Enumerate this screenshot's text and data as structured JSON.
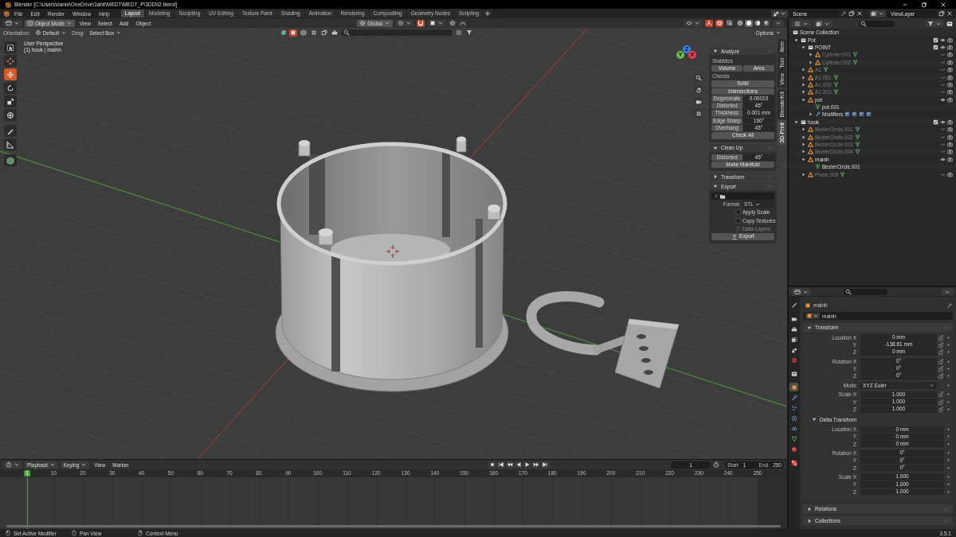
{
  "window": {
    "title": "Blender [C:\\Users\\danie\\OneDrive\\3ahit\\MEDT\\MEDT_P\\3DD\\t2.blend]"
  },
  "menu": [
    "File",
    "Edit",
    "Render",
    "Window",
    "Help"
  ],
  "workspaces": [
    {
      "label": "Layout",
      "selected": true
    },
    {
      "label": "Modeling",
      "selected": false
    },
    {
      "label": "Sculpting",
      "selected": false
    },
    {
      "label": "UV Editing",
      "selected": false
    },
    {
      "label": "Texture Paint",
      "selected": false
    },
    {
      "label": "Shading",
      "selected": false
    },
    {
      "label": "Animation",
      "selected": false
    },
    {
      "label": "Rendering",
      "selected": false
    },
    {
      "label": "Compositing",
      "selected": false
    },
    {
      "label": "Geometry Nodes",
      "selected": false
    },
    {
      "label": "Scripting",
      "selected": false
    }
  ],
  "scene": "Scene",
  "view_layer": "ViewLayer",
  "viewport": {
    "mode": "Object Mode",
    "menus": [
      "View",
      "Select",
      "Add",
      "Object"
    ],
    "transform_orientation": "Global",
    "options": "Options",
    "orientation_label": "Orientation:",
    "orientation": "Default",
    "drag_label": "Drag:",
    "drag": "Select Box",
    "info": [
      "User Perspective",
      "(1) hook | mainh"
    ],
    "shading": [
      {
        "kind": "wireframe",
        "selected": false
      },
      {
        "kind": "solid",
        "selected": true
      },
      {
        "kind": "material",
        "selected": false
      },
      {
        "kind": "rendered",
        "selected": false
      }
    ],
    "tools": [
      {
        "kind": "select",
        "selected": false
      },
      {
        "kind": "cursor",
        "selected": false
      },
      {
        "kind": "move",
        "selected": true
      },
      {
        "kind": "rotate",
        "selected": false
      },
      {
        "kind": "scale",
        "selected": false
      },
      {
        "kind": "transform",
        "selected": false
      },
      {
        "kind": "annotate",
        "selected": false
      },
      {
        "kind": "measure",
        "selected": false
      },
      {
        "kind": "add_cube",
        "selected": false
      }
    ],
    "gizmo": [
      {
        "label": "Z",
        "color": "#2f86f0"
      },
      {
        "label": "Y",
        "color": "#6bbd4d"
      },
      {
        "label": "X",
        "color": "#f0374f"
      }
    ],
    "sidebar": {
      "tabs": [
        {
          "label": "Item",
          "selected": false
        },
        {
          "label": "Tool",
          "selected": false
        },
        {
          "label": "View",
          "selected": false
        },
        {
          "label": "BlenderKit",
          "selected": false
        },
        {
          "label": "3D-Print",
          "selected": true
        }
      ],
      "panels": [
        {
          "title": "Analyze",
          "expanded": true,
          "rows": [
            {
              "kind": "label",
              "text": "Statistics"
            },
            {
              "kind": "buttons",
              "items": [
                "Volume",
                "Area"
              ]
            },
            {
              "kind": "label",
              "text": "Checks"
            },
            {
              "kind": "button",
              "text": "Solid"
            },
            {
              "kind": "button",
              "text": "Intersections"
            },
            {
              "kind": "prop",
              "label": "Degenerate",
              "value": "0.00010"
            },
            {
              "kind": "prop",
              "label": "Distorted",
              "value": "45°"
            },
            {
              "kind": "prop",
              "label": "Thickness",
              "value": "0.001 mm"
            },
            {
              "kind": "prop",
              "label": "Edge Sharp",
              "value": "160°"
            },
            {
              "kind": "prop",
              "label": "Overhang",
              "value": "45°"
            },
            {
              "kind": "button",
              "text": "Check All"
            }
          ]
        },
        {
          "title": "Clean Up",
          "expanded": true,
          "rows": [
            {
              "kind": "prop",
              "label": "Distorted",
              "value": "45°"
            },
            {
              "kind": "button",
              "text": "Make Manifold"
            }
          ]
        },
        {
          "title": "Transform",
          "expanded": false
        },
        {
          "title": "Export",
          "expanded": true,
          "rows": [
            {
              "kind": "path",
              "value": "//"
            },
            {
              "kind": "select",
              "label": "Format",
              "value": "STL"
            },
            {
              "kind": "checkbox",
              "label": "Apply Scale",
              "checked": false,
              "disabled": false
            },
            {
              "kind": "checkbox",
              "label": "Copy Textures",
              "checked": false,
              "disabled": false
            },
            {
              "kind": "checkbox",
              "label": "Data Layers",
              "checked": false,
              "disabled": true
            },
            {
              "kind": "icon_button",
              "text": "Export"
            }
          ]
        }
      ]
    }
  },
  "outliner": {
    "root": "Scene Collection",
    "items": [
      {
        "name": "Pot",
        "kind": "collection",
        "expanded": true,
        "checked": true,
        "hidden": false,
        "children": [
          {
            "name": "POINT",
            "kind": "collection",
            "expanded": true,
            "checked": true,
            "hidden": false,
            "children": [
              {
                "name": "Cylinder.001",
                "kind": "object",
                "expanded": false,
                "hidden": true
              },
              {
                "name": "Cylinder.002",
                "kind": "object",
                "expanded": false,
                "hidden": true
              }
            ]
          },
          {
            "name": "A1",
            "kind": "object",
            "expanded": false,
            "hidden": true
          },
          {
            "name": "A1.001",
            "kind": "object",
            "expanded": false,
            "hidden": true
          },
          {
            "name": "A1.002",
            "kind": "object",
            "expanded": false,
            "hidden": true
          },
          {
            "name": "A1.003",
            "kind": "object",
            "expanded": false,
            "hidden": true
          },
          {
            "name": "pot",
            "kind": "object",
            "expanded": true,
            "hidden": false,
            "children": [
              {
                "name": "pot.001",
                "kind": "mesh"
              },
              {
                "name": "Modifiers",
                "kind": "modifiers",
                "expanded": false
              }
            ]
          }
        ]
      },
      {
        "name": "hook",
        "kind": "collection",
        "expanded": true,
        "checked": true,
        "hidden": false,
        "children": [
          {
            "name": "BezierCircle.001",
            "kind": "object",
            "expanded": false,
            "hidden": true
          },
          {
            "name": "BezierCircle.002",
            "kind": "object",
            "expanded": false,
            "hidden": true
          },
          {
            "name": "BezierCircle.003",
            "kind": "object",
            "expanded": false,
            "hidden": true
          },
          {
            "name": "BezierCircle.004",
            "kind": "object",
            "expanded": false,
            "hidden": true
          },
          {
            "name": "mainh",
            "kind": "object",
            "expanded": true,
            "hidden": false,
            "children": [
              {
                "name": "BezierCircle.001",
                "kind": "mesh"
              }
            ]
          },
          {
            "name": "Plane.008",
            "kind": "object",
            "expanded": false,
            "hidden": true
          }
        ]
      }
    ]
  },
  "properties": {
    "tabs": [
      {
        "kind": "tool",
        "selected": false
      },
      {
        "kind": "render",
        "selected": false
      },
      {
        "kind": "output",
        "selected": false
      },
      {
        "kind": "view_layer",
        "selected": false
      },
      {
        "kind": "scene",
        "selected": false
      },
      {
        "kind": "world",
        "selected": false
      },
      {
        "kind": "collection",
        "selected": false
      },
      {
        "kind": "object",
        "selected": true
      },
      {
        "kind": "modifiers",
        "selected": false
      },
      {
        "kind": "particles",
        "selected": false
      },
      {
        "kind": "physics",
        "selected": false
      },
      {
        "kind": "constraints",
        "selected": false
      },
      {
        "kind": "data",
        "selected": false
      },
      {
        "kind": "material",
        "selected": false
      },
      {
        "kind": "texture",
        "selected": false
      }
    ],
    "object": "mainh",
    "datablock": "mainh",
    "panels": [
      {
        "title": "Transform",
        "expanded": true,
        "groups": [
          [
            {
              "kind": "number",
              "label": "Location X",
              "value": "0 mm",
              "locked": false
            },
            {
              "kind": "number",
              "label": "Y",
              "value": "-138.61 mm",
              "locked": false
            },
            {
              "kind": "number",
              "label": "Z",
              "value": "0 mm",
              "locked": false
            }
          ],
          [
            {
              "kind": "number",
              "label": "Rotation X",
              "value": "0°",
              "locked": false
            },
            {
              "kind": "number",
              "label": "Y",
              "value": "0°",
              "locked": false
            },
            {
              "kind": "number",
              "label": "Z",
              "value": "0°",
              "locked": false
            }
          ],
          [
            {
              "kind": "select",
              "label": "Mode",
              "value": "XYZ Euler"
            }
          ],
          [
            {
              "kind": "number",
              "label": "Scale X",
              "value": "1.000",
              "locked": false
            },
            {
              "kind": "number",
              "label": "Y",
              "value": "1.000",
              "locked": false
            },
            {
              "kind": "number",
              "label": "Z",
              "value": "1.000",
              "locked": false
            }
          ]
        ],
        "subpanels": [
          {
            "title": "Delta Transform",
            "expanded": true,
            "groups": [
              [
                {
                  "kind": "number",
                  "label": "Location X",
                  "value": "0 mm"
                },
                {
                  "kind": "number",
                  "label": "Y",
                  "value": "0 mm"
                },
                {
                  "kind": "number",
                  "label": "Z",
                  "value": "0 mm"
                }
              ],
              [
                {
                  "kind": "number",
                  "label": "Rotation X",
                  "value": "0°"
                },
                {
                  "kind": "number",
                  "label": "Y",
                  "value": "0°"
                },
                {
                  "kind": "number",
                  "label": "Z",
                  "value": "0°"
                }
              ],
              [
                {
                  "kind": "number",
                  "label": "Scale X",
                  "value": "1.000"
                },
                {
                  "kind": "number",
                  "label": "Y",
                  "value": "1.000"
                },
                {
                  "kind": "number",
                  "label": "Z",
                  "value": "1.000"
                }
              ]
            ]
          }
        ]
      },
      {
        "title": "Relations",
        "expanded": false
      },
      {
        "title": "Collections",
        "expanded": false
      }
    ]
  },
  "timeline": {
    "menus": [
      {
        "label": "Playback",
        "kind": "dropdown"
      },
      {
        "label": "Keying",
        "kind": "dropdown"
      },
      {
        "label": "View",
        "kind": "menu"
      },
      {
        "label": "Marker",
        "kind": "menu"
      }
    ],
    "current_frame": "1",
    "start_label": "Start",
    "start": "1",
    "end_label": "End",
    "end": "250",
    "ruler": [
      {
        "label": "1",
        "selected": true
      },
      {
        "label": "10",
        "selected": false
      },
      {
        "label": "20",
        "selected": false
      },
      {
        "label": "30",
        "selected": false
      },
      {
        "label": "40",
        "selected": false
      },
      {
        "label": "50",
        "selected": false
      },
      {
        "label": "60",
        "selected": false
      },
      {
        "label": "70",
        "selected": false
      },
      {
        "label": "80",
        "selected": false
      },
      {
        "label": "90",
        "selected": false
      },
      {
        "label": "100",
        "selected": false
      },
      {
        "label": "110",
        "selected": false
      },
      {
        "label": "120",
        "selected": false
      },
      {
        "label": "130",
        "selected": false
      },
      {
        "label": "140",
        "selected": false
      },
      {
        "label": "150",
        "selected": false
      },
      {
        "label": "160",
        "selected": false
      },
      {
        "label": "170",
        "selected": false
      },
      {
        "label": "180",
        "selected": false
      },
      {
        "label": "190",
        "selected": false
      },
      {
        "label": "200",
        "selected": false
      },
      {
        "label": "210",
        "selected": false
      },
      {
        "label": "220",
        "selected": false
      },
      {
        "label": "230",
        "selected": false
      },
      {
        "label": "240",
        "selected": false
      },
      {
        "label": "250",
        "selected": false
      }
    ]
  },
  "status_bar": {
    "hints": [
      "Set Active Modifier",
      "Pan View",
      "Context Menu"
    ],
    "version": "3.5.1"
  }
}
